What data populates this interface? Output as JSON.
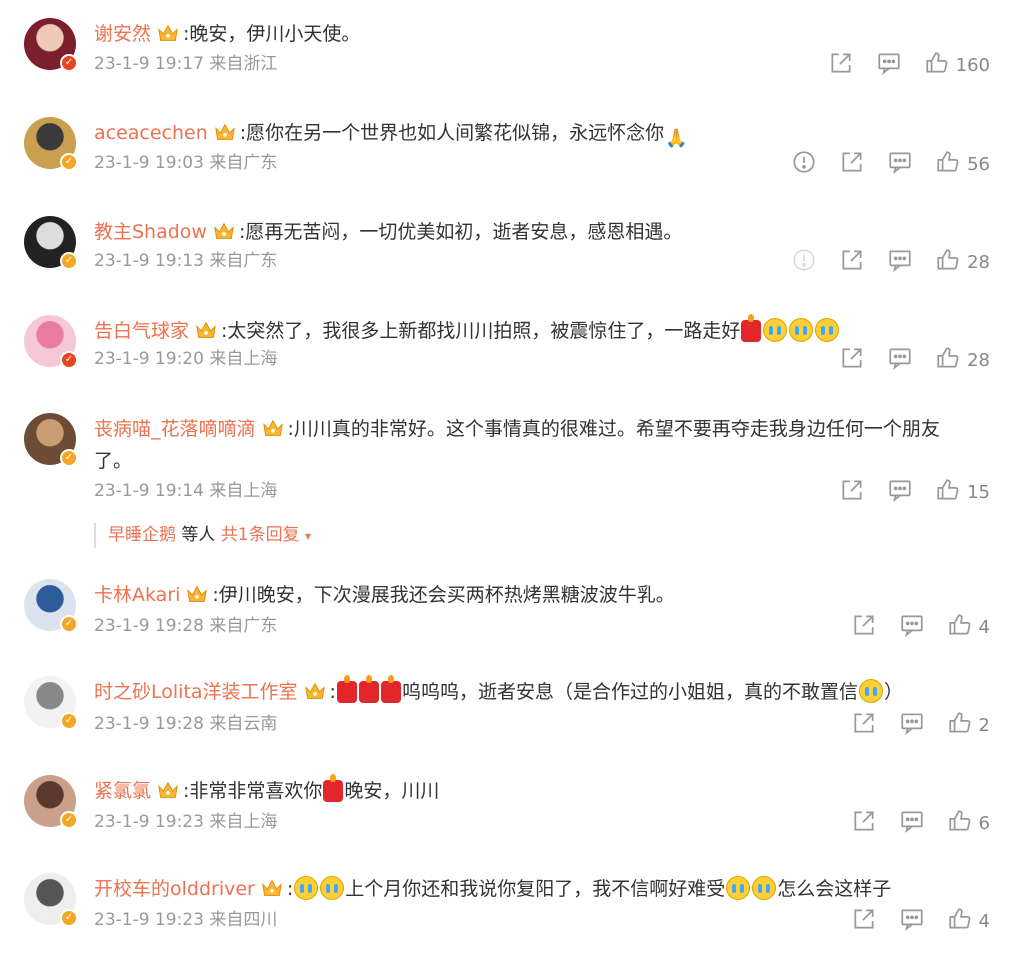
{
  "comments": [
    {
      "name": "谢安然",
      "text_parts": [
        {
          "t": ":晚安，伊川小天使。"
        }
      ],
      "meta": "23-1-9 19:17 来自浙江",
      "likes": "160",
      "report": false,
      "report_faint": false,
      "badge": "red"
    },
    {
      "name": "aceacechen",
      "text_parts": [
        {
          "t": ":愿你在另一个世界也如人间繁花似锦，永远怀念你"
        },
        {
          "e": "pray"
        }
      ],
      "meta": "23-1-9 19:03 来自广东",
      "likes": "56",
      "report": true,
      "report_faint": false,
      "badge": "gold"
    },
    {
      "name": "教主Shadow",
      "text_parts": [
        {
          "t": ":愿再无苦闷，一切优美如初，逝者安息，感恩相遇。"
        }
      ],
      "meta": "23-1-9 19:13 来自广东",
      "likes": "28",
      "report": true,
      "report_faint": true,
      "badge": "gold"
    },
    {
      "name": "告白气球家",
      "text_parts": [
        {
          "t": ":太突然了，我很多上新都找川川拍照，被震惊住了，一路走好"
        },
        {
          "e": "candle"
        },
        {
          "e": "cry"
        },
        {
          "e": "cry"
        },
        {
          "e": "cry"
        }
      ],
      "meta": "23-1-9 19:20 来自上海",
      "likes": "28",
      "report": false,
      "report_faint": false,
      "badge": "red"
    },
    {
      "name": "丧病喵_花落嘀嘀滴",
      "text_parts": [
        {
          "t": ":川川真的非常好。这个事情真的很难过。希望不要再夺走我身边任何一个朋友了。"
        }
      ],
      "meta": "23-1-9 19:14 来自上海",
      "likes": "15",
      "report": false,
      "report_faint": false,
      "badge": "gold"
    },
    {
      "name": "卡林Akari",
      "text_parts": [
        {
          "t": ":伊川晚安，下次漫展我还会买两杯热烤黑糖波波牛乳。"
        }
      ],
      "meta": "23-1-9 19:28 来自广东",
      "likes": "4",
      "report": false,
      "report_faint": false,
      "badge": "gold"
    },
    {
      "name": "时之砂Lolita洋装工作室",
      "text_parts": [
        {
          "t": ":"
        },
        {
          "e": "candle"
        },
        {
          "e": "candle"
        },
        {
          "e": "candle"
        },
        {
          "t": "呜呜呜，逝者安息（是合作过的小姐姐，真的不敢置信"
        },
        {
          "e": "cry"
        },
        {
          "t": "）"
        }
      ],
      "meta": "23-1-9 19:28 来自云南",
      "likes": "2",
      "report": false,
      "report_faint": false,
      "badge": "gold"
    },
    {
      "name": "紧氯氯",
      "text_parts": [
        {
          "t": ":非常非常喜欢你"
        },
        {
          "e": "candle"
        },
        {
          "t": "晚安，川川"
        }
      ],
      "meta": "23-1-9 19:23 来自上海",
      "likes": "6",
      "report": false,
      "report_faint": false,
      "badge": "gold"
    },
    {
      "name": "开校车的olddriver",
      "text_parts": [
        {
          "t": ":"
        },
        {
          "e": "cry"
        },
        {
          "e": "cry"
        },
        {
          "t": "上个月你还和我说你复阳了，我不信啊好难受"
        },
        {
          "e": "cry"
        },
        {
          "e": "cry"
        },
        {
          "t": "怎么会这样子"
        }
      ],
      "meta": "23-1-9 19:23 来自四川",
      "likes": "4",
      "report": false,
      "report_faint": false,
      "badge": "gold"
    }
  ],
  "reply_summary": {
    "name": "早睡企鹅",
    "suffix": " 等人",
    "more": "共1条回复",
    "arrow": "▾"
  },
  "colors": {
    "username": "#eb7350",
    "meta": "#999999",
    "text": "#333333",
    "vip_gold": "#f5a623",
    "vip_red": "#e8441f"
  },
  "icons": {
    "share": "share-icon",
    "comment": "comment-icon",
    "like": "thumbs-up-icon",
    "report": "report-icon",
    "crown": "vip-crown-icon"
  }
}
